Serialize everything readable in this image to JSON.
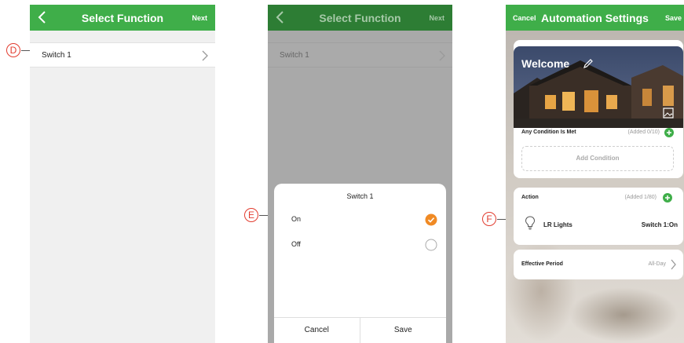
{
  "screens": {
    "select1": {
      "title": "Select Function",
      "next": "Next",
      "item": "Switch 1"
    },
    "select2": {
      "title": "Select Function",
      "next": "Next",
      "item": "Switch 1",
      "sheet": {
        "title": "Switch 1",
        "options": [
          {
            "label": "On",
            "selected": true
          },
          {
            "label": "Off",
            "selected": false
          }
        ],
        "cancel": "Cancel",
        "save": "Save"
      }
    },
    "automation": {
      "cancel": "Cancel",
      "title": "Automation Settings",
      "save": "Save",
      "welcome": "Welcome",
      "condition": {
        "title": "Any Condition Is Met",
        "added": "(Added 0/10)",
        "add_label": "Add Condition"
      },
      "action": {
        "title": "Action",
        "added": "(Added 1/80)",
        "device": "LR Lights",
        "state": "Switch 1:On"
      },
      "period": {
        "title": "Effective Period",
        "value": "All-Day"
      }
    }
  },
  "callouts": [
    "D",
    "E",
    "F"
  ],
  "colors": {
    "accent_green": "#3fae49",
    "check_orange": "#f08a24",
    "callout_red": "#e23c2f"
  },
  "icons": [
    "back-arrow-icon",
    "chevron-right-icon",
    "check-circle-icon",
    "empty-circle-icon",
    "pencil-icon",
    "image-icon",
    "plus-circle-icon",
    "lightbulb-icon"
  ]
}
